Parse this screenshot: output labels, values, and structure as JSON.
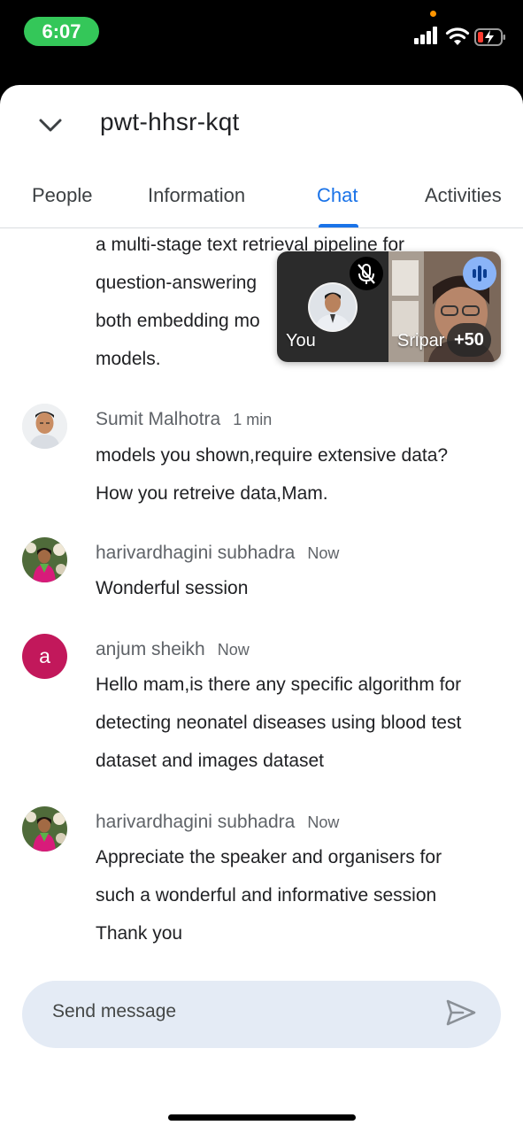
{
  "status_bar": {
    "time": "6:07",
    "icons": [
      "cellular-signal-icon",
      "wifi-icon",
      "battery-charging-icon"
    ],
    "time_pill_color": "#34c759",
    "privacy_dot_color": "#ff9500"
  },
  "header": {
    "meeting_code": "pwt-hhsr-kqt",
    "collapse_icon": "chevron-down-icon"
  },
  "tabs": [
    {
      "label": "People",
      "active": false
    },
    {
      "label": "Information",
      "active": false
    },
    {
      "label": "Chat",
      "active": true
    },
    {
      "label": "Activities",
      "active": false
    }
  ],
  "accent_color": "#1a73e8",
  "pip": {
    "self_label": "You",
    "self_mic_icon": "mic-off-icon",
    "other_label": "Sripar",
    "participants_badge": "+50",
    "speaking_icon": "audio-levels-icon"
  },
  "chat": {
    "partial_message": {
      "lines": [
        "a multi-stage text retrieval pipeline for",
        "question-answering",
        "both embedding mo",
        "models."
      ]
    },
    "messages": [
      {
        "sender": "Sumit Malhotra",
        "time": "1 min",
        "avatar": "photo",
        "lines": [
          "models you shown,require  extensive data?",
          "How you  retreive data,Mam."
        ]
      },
      {
        "sender": "harivardhagini subhadra",
        "time": "Now",
        "avatar": "photo",
        "lines": [
          "Wonderful session"
        ]
      },
      {
        "sender": "anjum sheikh",
        "time": "Now",
        "avatar_letter": "a",
        "avatar_color": "#c2185b",
        "lines": [
          "Hello mam,is there any specific algorithm for",
          "detecting neonatel diseases using blood test",
          "dataset and images dataset"
        ]
      },
      {
        "sender": "harivardhagini subhadra",
        "time": "Now",
        "avatar": "photo",
        "lines": [
          "Appreciate the speaker and  organisers  for",
          "such a wonderful and informative session",
          "Thank you"
        ]
      }
    ]
  },
  "composer": {
    "placeholder": "Send message",
    "send_icon": "send-icon"
  }
}
